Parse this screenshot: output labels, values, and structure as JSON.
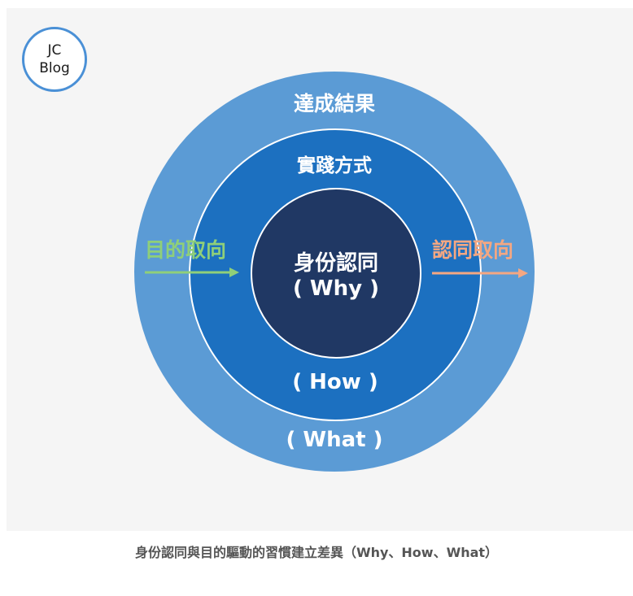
{
  "logo": {
    "line1": "JC",
    "line2": "Blog"
  },
  "diagram": {
    "outer_ring": {
      "label_top": "達成結果",
      "label_bottom": "( What )",
      "color": "#5b9bd5"
    },
    "middle_ring": {
      "label_top": "實踐方式",
      "label_bottom": "( How )",
      "color": "#1c70c0"
    },
    "inner_circle": {
      "label_line1": "身份認同",
      "label_line2": "( Why )",
      "color": "#203864"
    },
    "left_arrow": {
      "label": "目的取向",
      "color": "#8fcf79"
    },
    "right_arrow": {
      "label": "認同取向",
      "color": "#f4a782"
    }
  },
  "caption": "身份認同與目的驅動的習慣建立差異（Why、How、What）"
}
